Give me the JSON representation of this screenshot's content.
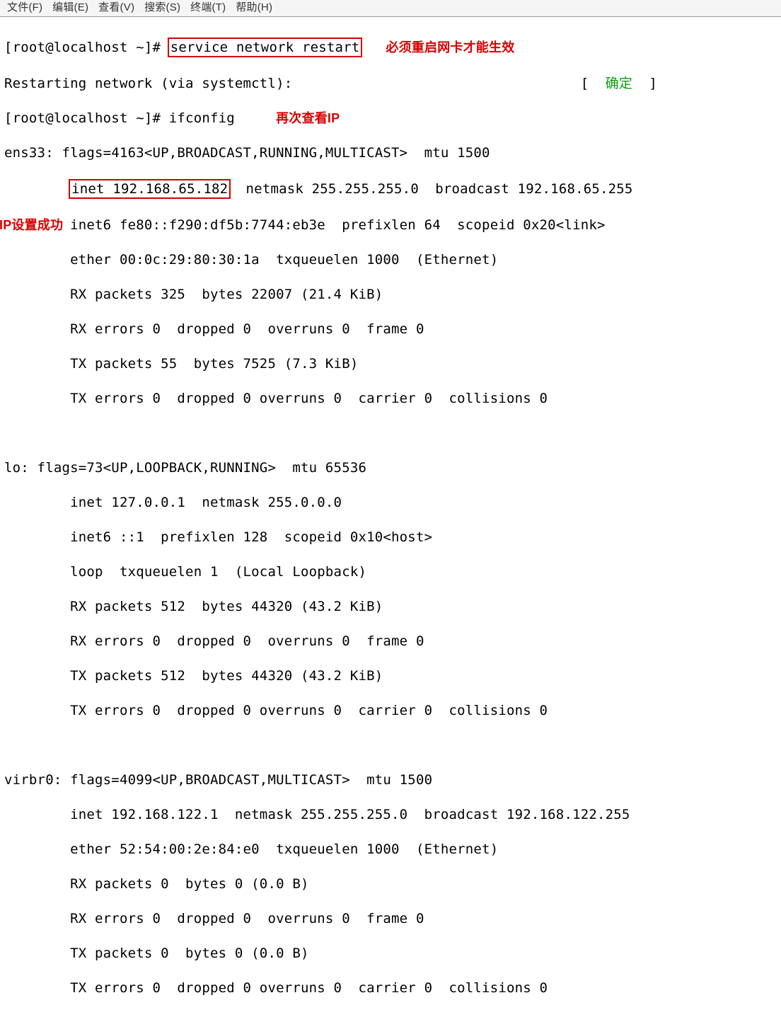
{
  "menubar": {
    "file": "文件(F)",
    "edit": "编辑(E)",
    "view": "查看(V)",
    "search": "搜索(S)",
    "terminal": "终端(T)",
    "help": "帮助(H)"
  },
  "annotations": {
    "must_restart": "必须重启网卡才能生效",
    "check_again": "再次查看IP",
    "ip_success": "IP设置成功"
  },
  "terminal": {
    "prompt1": "[root@localhost ~]# ",
    "cmd1": "service network restart",
    "restart_line_left": "Restarting network (via systemctl):",
    "bracket_left": "[",
    "ok": "  确定  ",
    "bracket_right": "]",
    "prompt2": "[root@localhost ~]# ",
    "cmd2": "ifconfig",
    "ens33_header": "ens33: flags=4163<UP,BROADCAST,RUNNING,MULTICAST>  mtu 1500",
    "ens33_inet": "inet 192.168.65.182",
    "ens33_inet_rest": "  netmask 255.255.255.0  broadcast 192.168.65.255",
    "ens33_l3": "        inet6 fe80::f290:df5b:7744:eb3e  prefixlen 64  scopeid 0x20<link>",
    "ens33_l4": "        ether 00:0c:29:80:30:1a  txqueuelen 1000  (Ethernet)",
    "ens33_l5": "        RX packets 325  bytes 22007 (21.4 KiB)",
    "ens33_l6": "        RX errors 0  dropped 0  overruns 0  frame 0",
    "ens33_l7": "        TX packets 55  bytes 7525 (7.3 KiB)",
    "ens33_l8": "        TX errors 0  dropped 0 overruns 0  carrier 0  collisions 0",
    "blank": " ",
    "lo_header": "lo: flags=73<UP,LOOPBACK,RUNNING>  mtu 65536",
    "lo_l2": "        inet 127.0.0.1  netmask 255.0.0.0",
    "lo_l3": "        inet6 ::1  prefixlen 128  scopeid 0x10<host>",
    "lo_l4": "        loop  txqueuelen 1  (Local Loopback)",
    "lo_l5": "        RX packets 512  bytes 44320 (43.2 KiB)",
    "lo_l6": "        RX errors 0  dropped 0  overruns 0  frame 0",
    "lo_l7": "        TX packets 512  bytes 44320 (43.2 KiB)",
    "lo_l8": "        TX errors 0  dropped 0 overruns 0  carrier 0  collisions 0",
    "virbr0_header": "virbr0: flags=4099<UP,BROADCAST,MULTICAST>  mtu 1500",
    "virbr0_l2": "        inet 192.168.122.1  netmask 255.255.255.0  broadcast 192.168.122.255",
    "virbr0_l3": "        ether 52:54:00:2e:84:e0  txqueuelen 1000  (Ethernet)",
    "virbr0_l4": "        RX packets 0  bytes 0 (0.0 B)",
    "virbr0_l5": "        RX errors 0  dropped 0  overruns 0  frame 0",
    "virbr0_l6": "        TX packets 0  bytes 0 (0.0 B)",
    "virbr0_l7": "        TX errors 0  dropped 0 overruns 0  carrier 0  collisions 0"
  }
}
